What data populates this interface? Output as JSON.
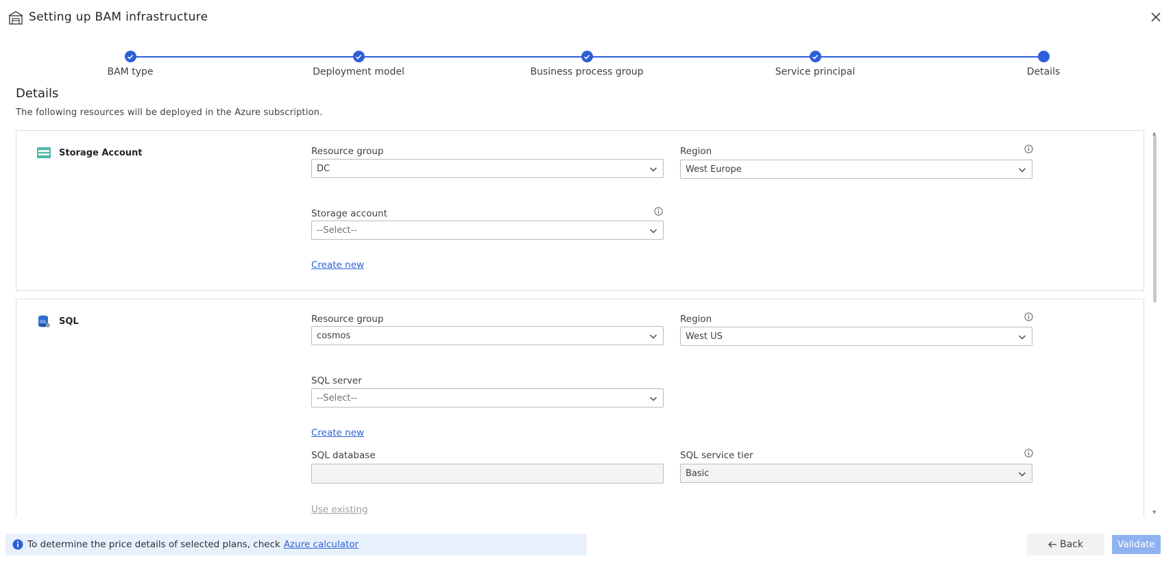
{
  "header": {
    "title": "Setting up BAM infrastructure"
  },
  "stepper": {
    "steps": [
      {
        "label": "BAM type",
        "state": "completed"
      },
      {
        "label": "Deployment model",
        "state": "completed"
      },
      {
        "label": "Business process group",
        "state": "completed"
      },
      {
        "label": "Service principal",
        "state": "completed"
      },
      {
        "label": "Details",
        "state": "current"
      }
    ]
  },
  "details": {
    "title": "Details",
    "description": "The following resources will be deployed in the Azure subscription."
  },
  "storage": {
    "title": "Storage Account",
    "resource_group_label": "Resource group",
    "resource_group_value": "DC",
    "region_label": "Region",
    "region_value": "West Europe",
    "storage_account_label": "Storage account",
    "storage_account_value": "--Select--",
    "create_new": "Create new"
  },
  "sql": {
    "title": "SQL",
    "resource_group_label": "Resource group",
    "resource_group_value": "cosmos",
    "region_label": "Region",
    "region_value": "West US",
    "server_label": "SQL server",
    "server_value": "--Select--",
    "create_new": "Create new",
    "database_label": "SQL database",
    "database_value": "",
    "tier_label": "SQL service tier",
    "tier_value": "Basic",
    "use_existing": "Use existing"
  },
  "footer": {
    "info_text": "To determine the price details of selected plans, check",
    "info_link": "Azure calculator",
    "back_label": "Back",
    "validate_label": "Validate"
  },
  "colors": {
    "accent": "#2d5fd8",
    "validate_disabled": "#8fb2f0",
    "info_bg": "#e8f1fb"
  }
}
